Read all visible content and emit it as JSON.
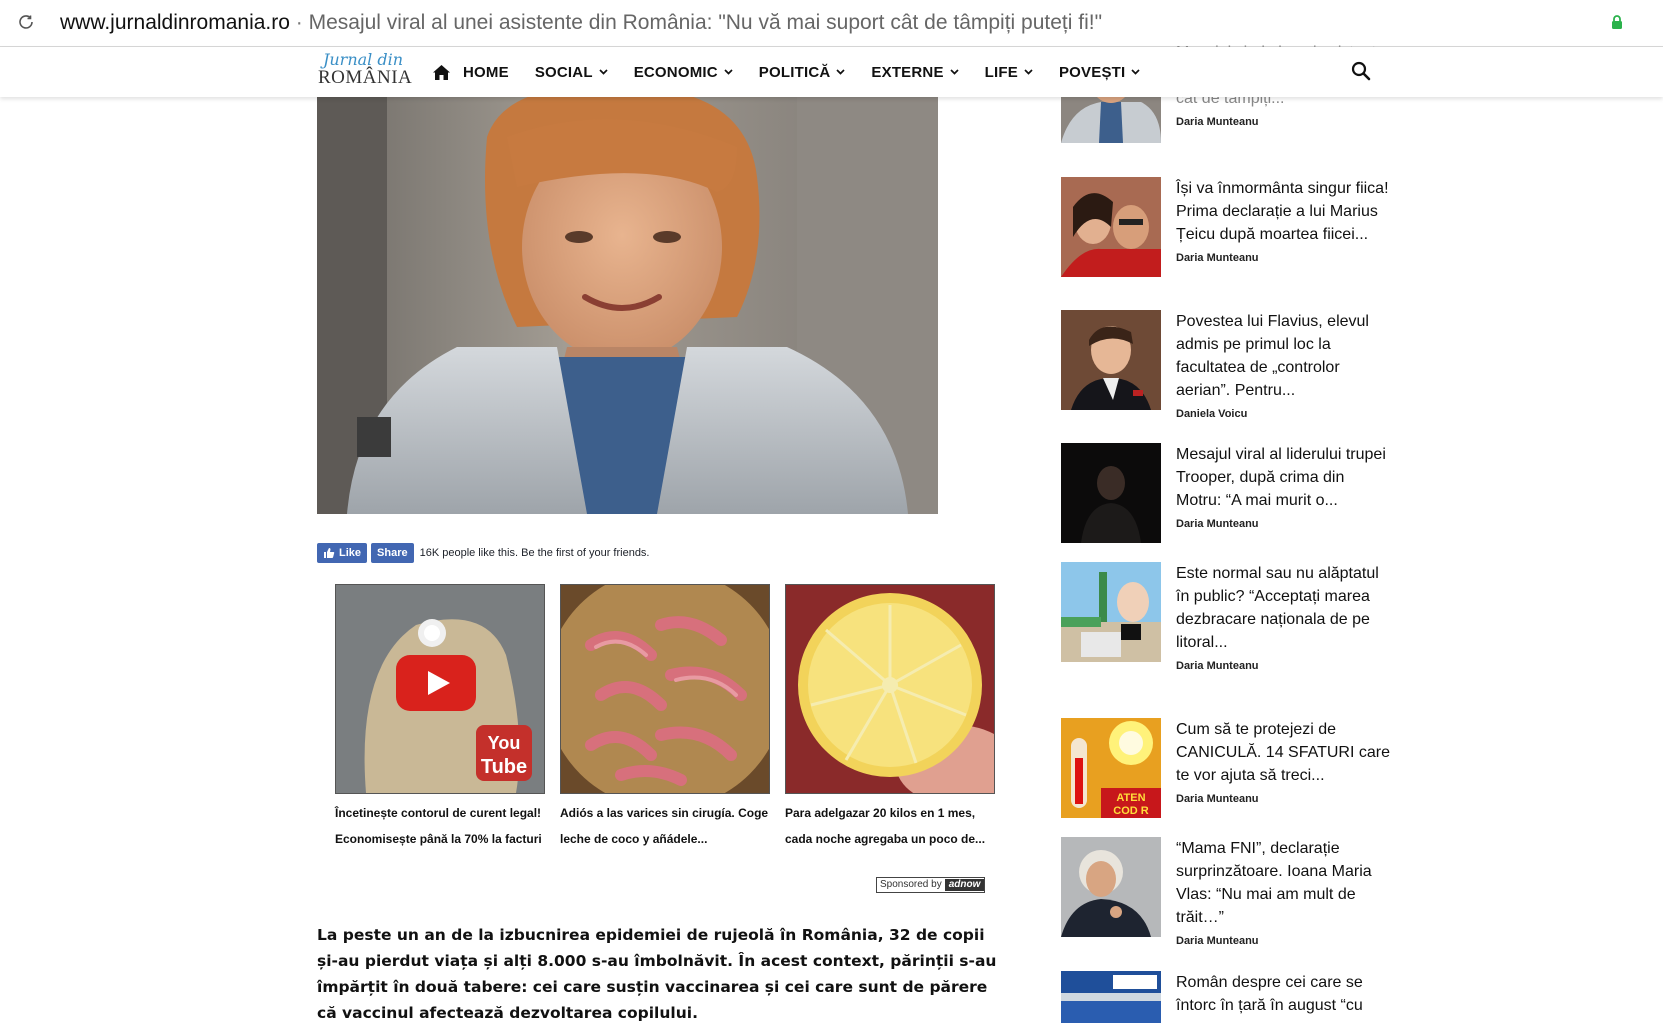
{
  "browser": {
    "domain": "www.jurnaldinromania.ro",
    "separator": " · ",
    "page_title": "Mesajul viral al unei asistente din România: \"Nu vă mai suport cât de tâmpiți puteți fi!\""
  },
  "site": {
    "logo_line1": "Jurnal din",
    "logo_line2": "ROMÂNIA"
  },
  "nav": {
    "items": [
      {
        "label": "HOME"
      },
      {
        "label": "SOCIAL"
      },
      {
        "label": "ECONOMIC"
      },
      {
        "label": "POLITICĂ"
      },
      {
        "label": "EXTERNE"
      },
      {
        "label": "LIFE"
      },
      {
        "label": "POVEȘTI"
      }
    ]
  },
  "facebook": {
    "like_label": "Like",
    "share_label": "Share",
    "social_text": "16K people like this. Be the first of your friends."
  },
  "ads": [
    {
      "caption_line1": "Încetinește contorul de curent legal!",
      "caption_line2": "Economisește până la 70% la facturi"
    },
    {
      "caption_line1": "Adiós a las varices sin cirugía. Coge",
      "caption_line2": "leche de coco y añádele..."
    },
    {
      "caption_line1": "Para adelgazar 20 kilos en 1 mes,",
      "caption_line2": "cada noche agregaba un poco de..."
    }
  ],
  "sponsored": {
    "label": "Sponsored by",
    "brand": "adnow"
  },
  "article": {
    "lead": "La peste un an de la izbucnirea epidemiei de rujeolă în România, 32 de copii și-au pierdut viața și alți 8.000 s-au îmbolnăvit. În acest context, părinții s-au împărțit în două tabere: cei care susțin vaccinarea și cei care sunt de părere că vaccinul afectează dezvoltarea copilului."
  },
  "sidebar": {
    "items": [
      {
        "title": "Mesajul viral al unei asistente din România: va mai suport cat de tâmpiți...",
        "author": "Daria Munteanu"
      },
      {
        "title": "Își va înmormânta singur fiica! Prima declarație a lui Marius Țeicu după moartea fiicei...",
        "author": "Daria Munteanu"
      },
      {
        "title": "Povestea lui Flavius, elevul admis pe primul loc la facultatea de „controlor aerian”. Pentru...",
        "author": "Daniela Voicu"
      },
      {
        "title": "Mesajul viral al liderului trupei Trooper, după crima din Motru: “A mai murit o...",
        "author": "Daria Munteanu"
      },
      {
        "title": "Este normal sau nu alăptatul în public? “Acceptați marea dezbracare naționala de pe litoral...",
        "author": "Daria Munteanu"
      },
      {
        "title": "Cum să te protejezi de CANICULĂ. 14 SFATURI care te vor ajuta să treci...",
        "author": "Daria Munteanu"
      },
      {
        "title": "“Mama FNI”, declarație surprinzătoare. Ioana Maria Vlas: “Nu mai am mult de trăit…”",
        "author": "Daria Munteanu"
      },
      {
        "title": "Român despre cei care se întorc în țară în august “cu",
        "author": ""
      }
    ]
  },
  "colors": {
    "facebook_blue": "#4267b2",
    "logo_blue": "#3a8fc6",
    "secure_lock": "#2bb24c"
  }
}
